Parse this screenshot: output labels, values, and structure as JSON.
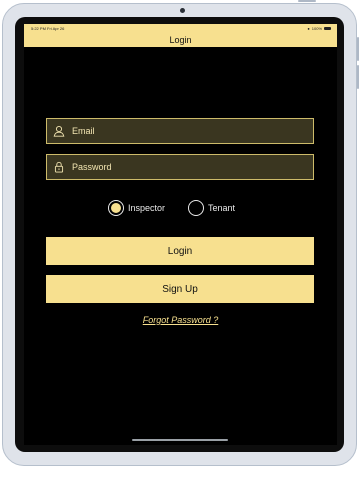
{
  "status_bar": {
    "time": "5:22 PM   Fri Apr 26",
    "battery": "100%"
  },
  "nav": {
    "title": "Login"
  },
  "form": {
    "email_placeholder": "Email",
    "password_placeholder": "Password",
    "roles": [
      {
        "label": "Inspector",
        "selected": true
      },
      {
        "label": "Tenant",
        "selected": false
      }
    ]
  },
  "buttons": {
    "login": "Login",
    "signup": "Sign Up"
  },
  "links": {
    "forgot": "Forgot Password ?"
  },
  "colors": {
    "accent": "#f7e08f",
    "background": "#000000",
    "field_bg": "#3a3620"
  }
}
